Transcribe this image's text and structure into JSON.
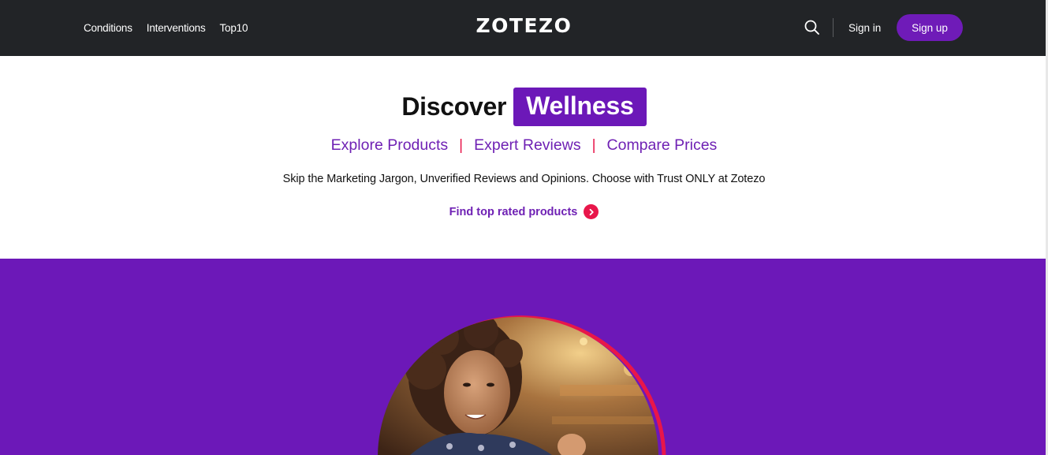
{
  "header": {
    "nav_links": [
      {
        "label": "Conditions"
      },
      {
        "label": "Interventions"
      },
      {
        "label": "Top10"
      }
    ],
    "logo": "ZOTEZO",
    "search_icon": "search-icon",
    "signin_label": "Sign in",
    "signup_label": "Sign up"
  },
  "hero": {
    "title_plain": "Discover",
    "title_highlight": "Wellness",
    "links": [
      {
        "label": "Explore Products"
      },
      {
        "label": "Expert Reviews"
      },
      {
        "label": "Compare Prices"
      }
    ],
    "separator": "|",
    "tagline": "Skip the Marketing Jargon, Unverified Reviews and Opinions. Choose with Trust ONLY at Zotezo",
    "cta_label": "Find top rated products",
    "cta_icon": "chevron-right-icon"
  },
  "colors": {
    "header_bg": "#222427",
    "brand_purple": "#6c18b8",
    "accent_red": "#e8164a",
    "link_purple": "#6f21b4"
  }
}
